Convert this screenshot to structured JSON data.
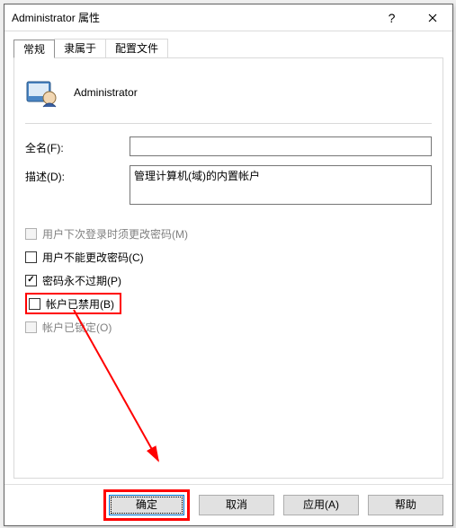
{
  "title": "Administrator 属性",
  "tabs": {
    "general": "常规",
    "memberof": "隶属于",
    "profile": "配置文件"
  },
  "account_name": "Administrator",
  "labels": {
    "fullname": "全名(F):",
    "description": "描述(D):"
  },
  "values": {
    "fullname": "",
    "description": "管理计算机(域)的内置帐户"
  },
  "checks": {
    "must_change": "用户下次登录时须更改密码(M)",
    "cannot_change": "用户不能更改密码(C)",
    "never_expires": "密码永不过期(P)",
    "disabled": "帐户已禁用(B)",
    "locked": "帐户已锁定(O)"
  },
  "buttons": {
    "ok": "确定",
    "cancel": "取消",
    "apply": "应用(A)",
    "help": "帮助"
  }
}
